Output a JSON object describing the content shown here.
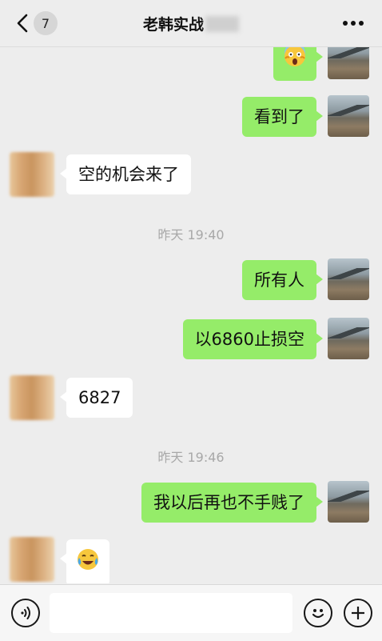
{
  "header": {
    "unread_count": "7",
    "title": "老韩实战"
  },
  "messages": {
    "m2": "看到了",
    "m3": "空的机会来了",
    "ts1": "昨天 19:40",
    "m4": "所有人",
    "m5": "以6860止损空",
    "m6": "6827",
    "ts2": "昨天 19:46",
    "m7": "我以后再也不手贱了"
  },
  "emojis": {
    "m1": "scream-emoji",
    "m8": "laugh-cry-emoji"
  },
  "colors": {
    "my_bubble": "#95ec69",
    "other_bubble": "#ffffff",
    "background": "#ededed"
  },
  "icons": {
    "back": "chevron-left-icon",
    "more": "more-dots-icon",
    "voice": "voice-icon",
    "emoji": "emoji-icon",
    "add": "add-icon"
  }
}
